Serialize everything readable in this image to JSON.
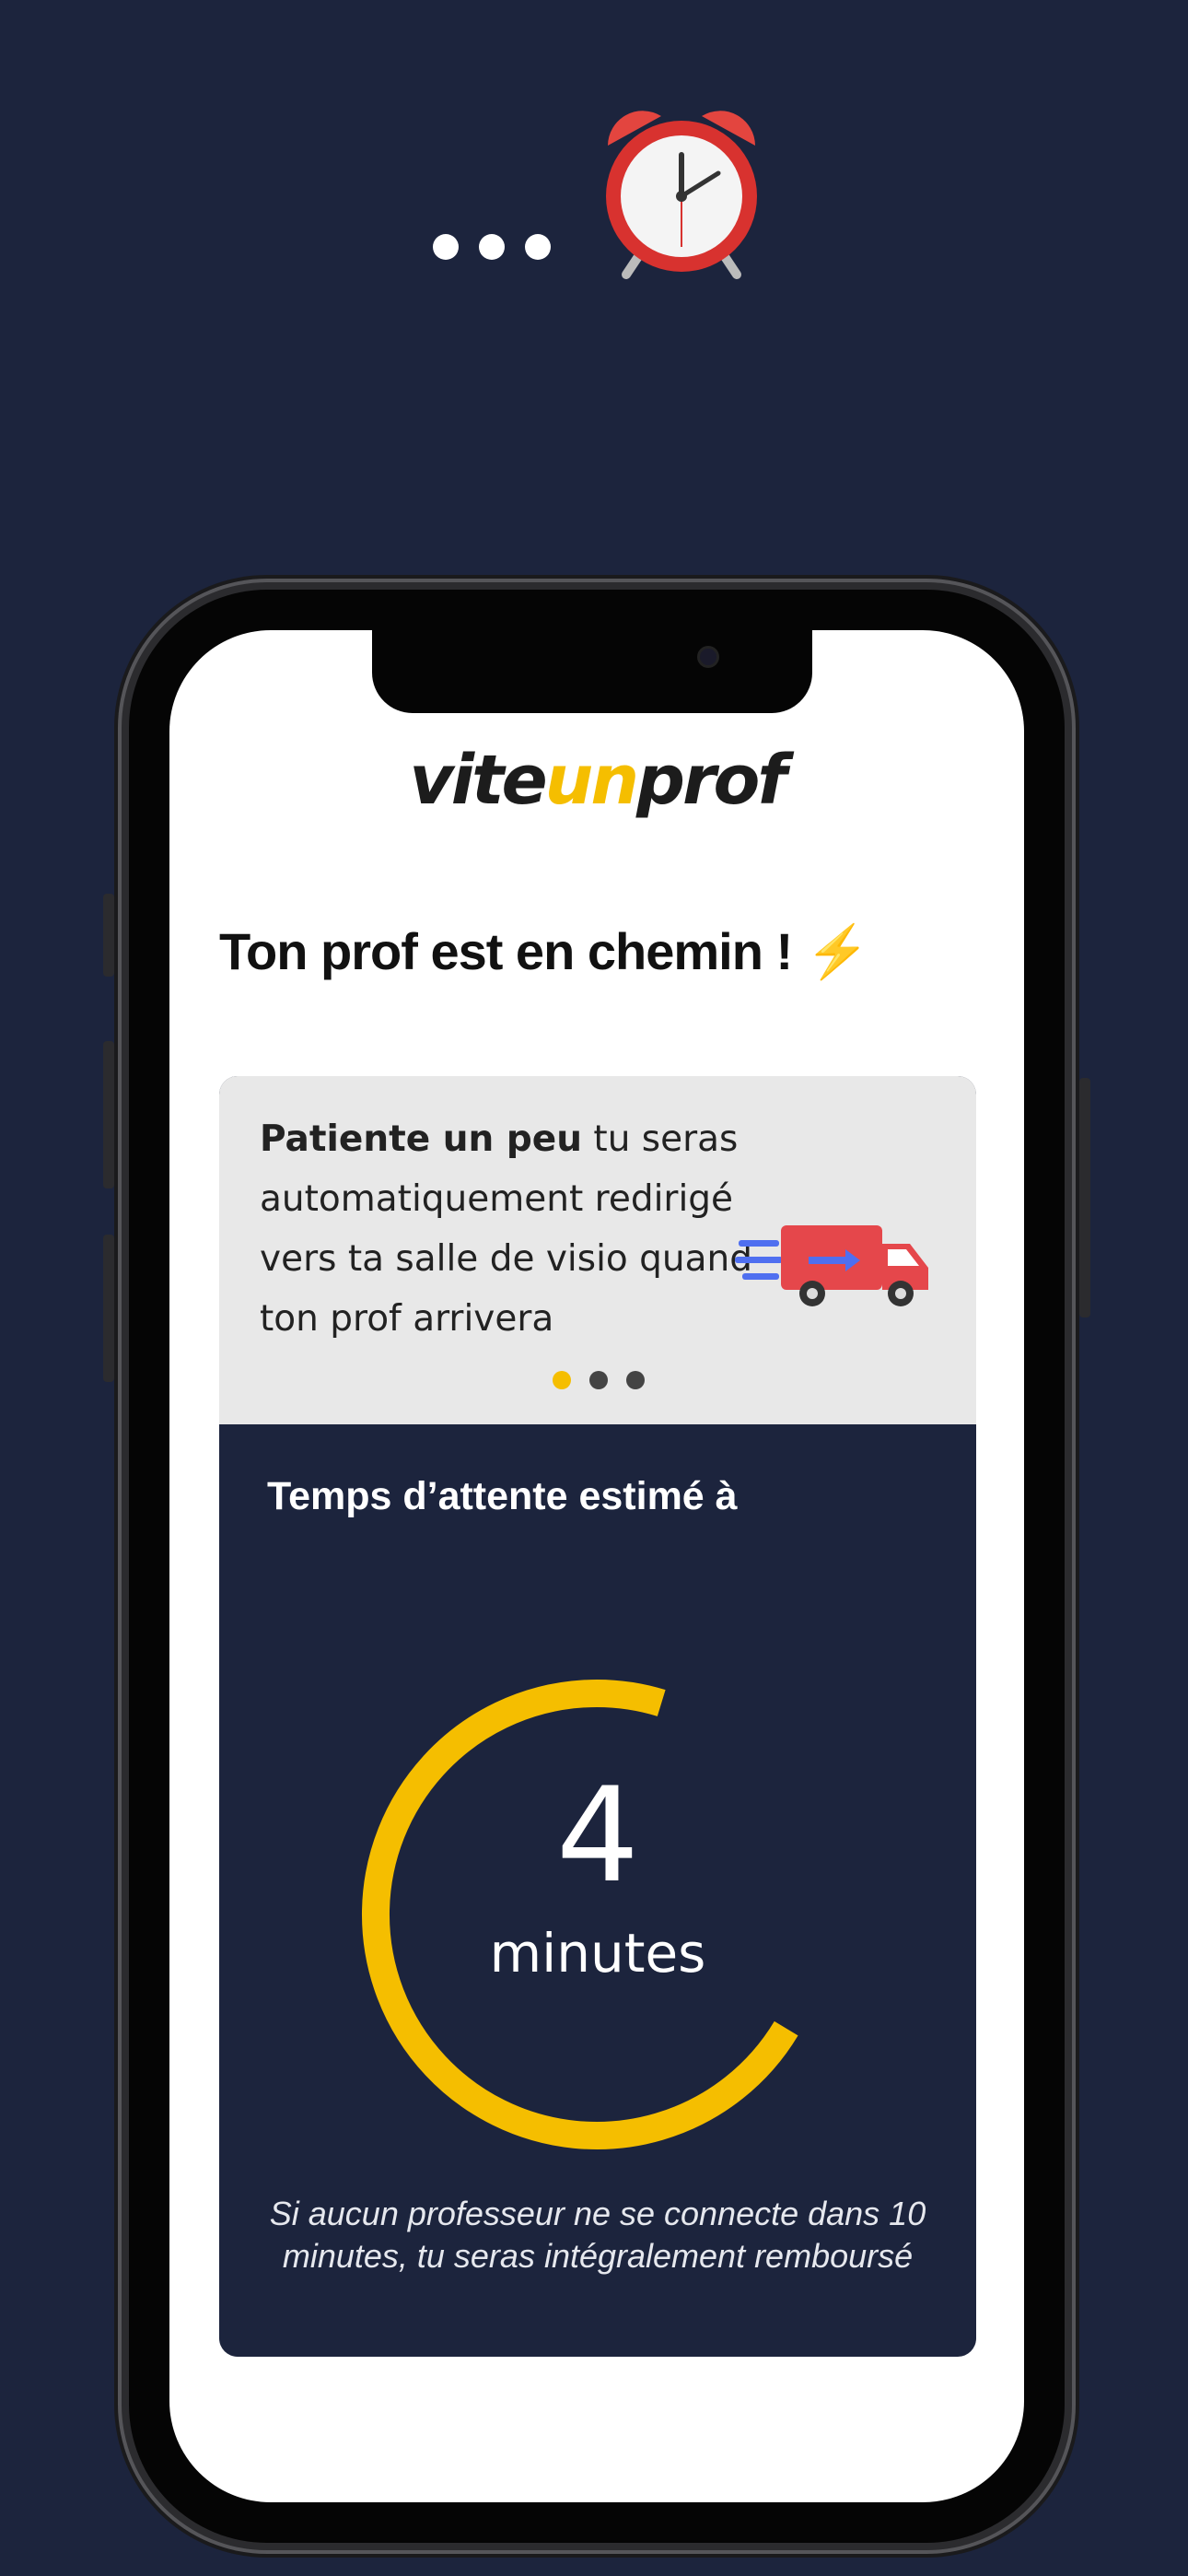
{
  "decoration": {
    "dots_count": 3,
    "alarm_icon": "alarm-clock-icon"
  },
  "app": {
    "logo_part1": "vite",
    "logo_part2": "un",
    "logo_part3": "prof",
    "brand_color": "#f5be00"
  },
  "screen": {
    "heading": "Ton prof est en chemin !",
    "heading_icon": "⚡",
    "info_card": {
      "text_bold": "Patiente un peu",
      "text_rest": " tu seras automatiquement redirigé vers ta salle de visio quand ton prof arrivera",
      "illustration": "delivery-truck-icon",
      "pager_count": 3,
      "pager_active": 1
    },
    "wait": {
      "label": "Temps d’attente estimé à",
      "value": "4",
      "unit": "minutes",
      "ring_progress": 0.6
    },
    "refund_note": "Si aucun professeur ne se connecte dans 10 minutes, tu seras intégralement remboursé"
  },
  "colors": {
    "background": "#1c243d",
    "accent": "#f5be00"
  }
}
